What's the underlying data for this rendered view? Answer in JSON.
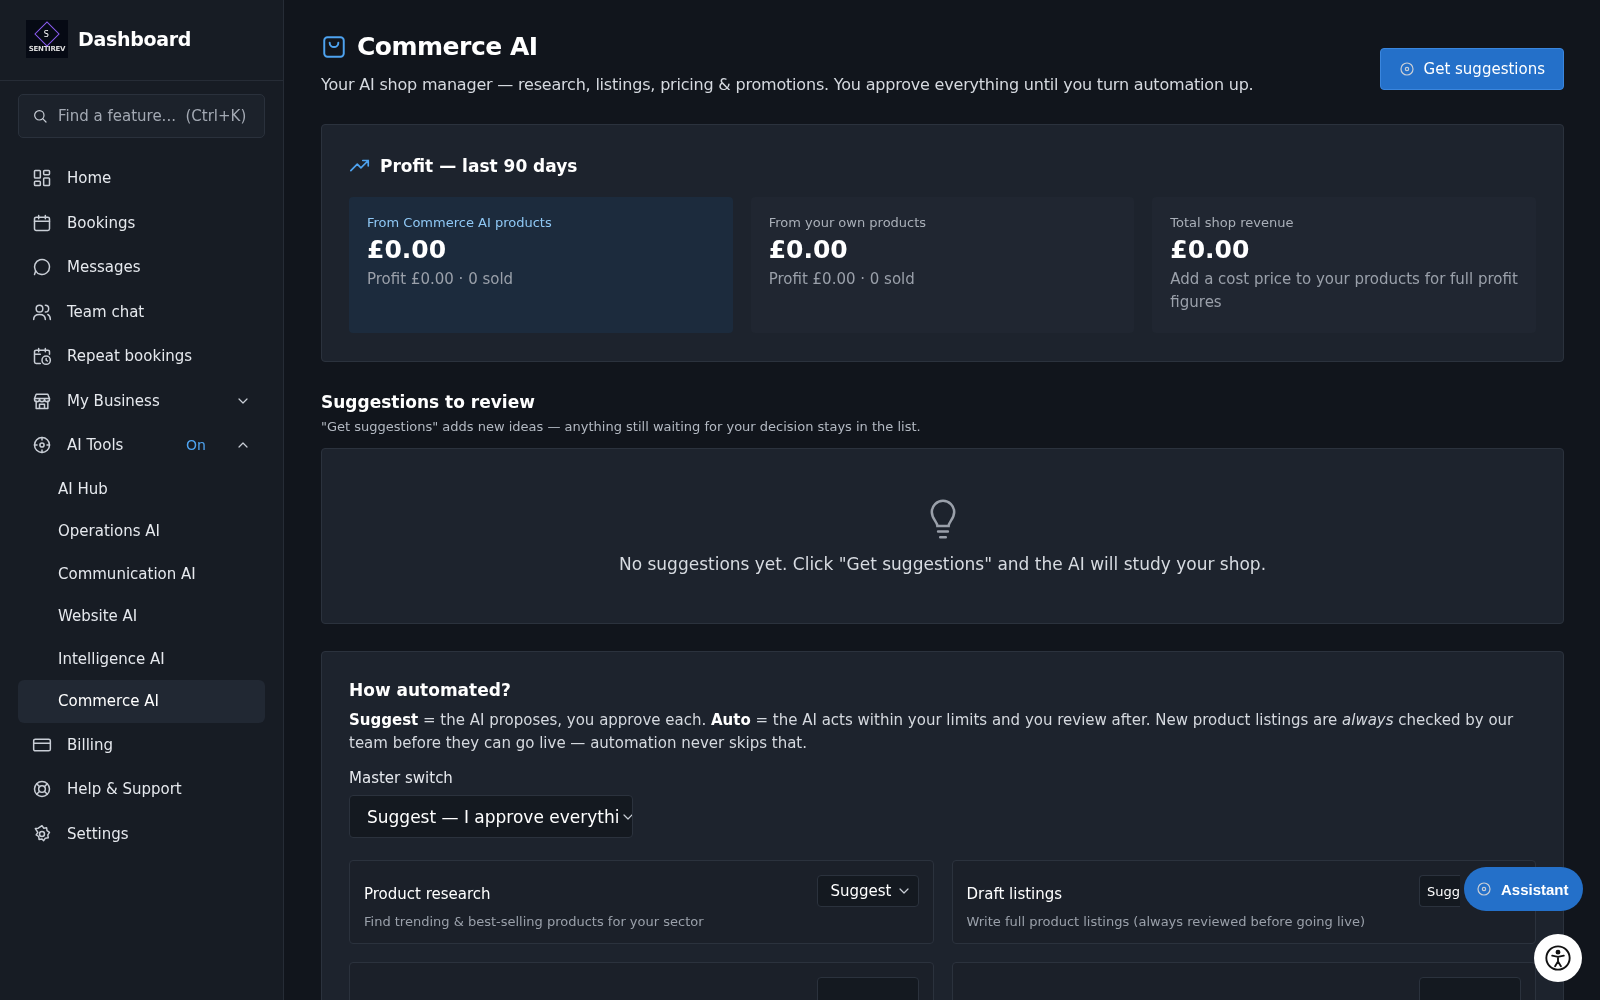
{
  "sidebar": {
    "logo": {
      "letter": "S",
      "caption": "SENTIREV"
    },
    "title": "Dashboard",
    "search": {
      "placeholder": "Find a feature...  (Ctrl+K)"
    },
    "items": [
      {
        "label": "Home",
        "selected": false
      },
      {
        "label": "Bookings",
        "selected": false
      },
      {
        "label": "Messages",
        "selected": false
      },
      {
        "label": "Team chat",
        "selected": false
      },
      {
        "label": "Repeat bookings",
        "selected": false
      },
      {
        "label": "My Business",
        "selected": false,
        "expanded": false
      },
      {
        "label": "AI Tools",
        "selected": false,
        "expanded": true,
        "badge": "On",
        "children": [
          {
            "label": "AI Hub",
            "selected": false
          },
          {
            "label": "Operations AI",
            "selected": false
          },
          {
            "label": "Communication AI",
            "selected": false
          },
          {
            "label": "Website AI",
            "selected": false
          },
          {
            "label": "Intelligence AI",
            "selected": false
          },
          {
            "label": "Commerce AI",
            "selected": true
          }
        ]
      },
      {
        "label": "Billing",
        "selected": false
      },
      {
        "label": "Help & Support",
        "selected": false
      },
      {
        "label": "Settings",
        "selected": false
      }
    ]
  },
  "header": {
    "title": "Commerce AI",
    "subtitle": "Your AI shop manager — research, listings, pricing & promotions. You approve everything until you turn automation up.",
    "button": "Get suggestions"
  },
  "profit": {
    "title": "Profit — last 90 days",
    "stats": [
      {
        "label": "From Commerce AI products",
        "value": "£0.00",
        "note": "Profit £0.00 · 0 sold",
        "highlighted": true
      },
      {
        "label": "From your own products",
        "value": "£0.00",
        "note": "Profit £0.00 · 0 sold",
        "highlighted": false
      },
      {
        "label": "Total shop revenue",
        "value": "£0.00",
        "note": "Add a cost price to your products for full profit figures",
        "highlighted": false
      }
    ]
  },
  "suggestions": {
    "title": "Suggestions to review",
    "subtitle": "\"Get suggestions\" adds new ideas — anything still waiting for your decision stays in the list.",
    "empty": "No suggestions yet. Click \"Get suggestions\" and the AI will study your shop."
  },
  "automation": {
    "title": "How automated?",
    "text": "**Suggest** = the AI proposes, you approve each. **Auto** = the AI acts within your limits and you review after. New product listings are *always* checked by our team before they can go live — automation never skips that.",
    "master_label": "Master switch",
    "master_value": "Suggest — I approve everythi",
    "tasks": [
      {
        "kind": "task",
        "title": "Product research",
        "description": "Find trending & best-selling products for your sector",
        "value": "Suggest"
      },
      {
        "kind": "task",
        "title": "Draft listings",
        "description": "Write full product listings (always reviewed before going live)",
        "value": "Sugg",
        "covered": true
      },
      {
        "kind": "partial"
      },
      {
        "kind": "partial"
      }
    ]
  },
  "assistant": {
    "label": "Assistant"
  }
}
